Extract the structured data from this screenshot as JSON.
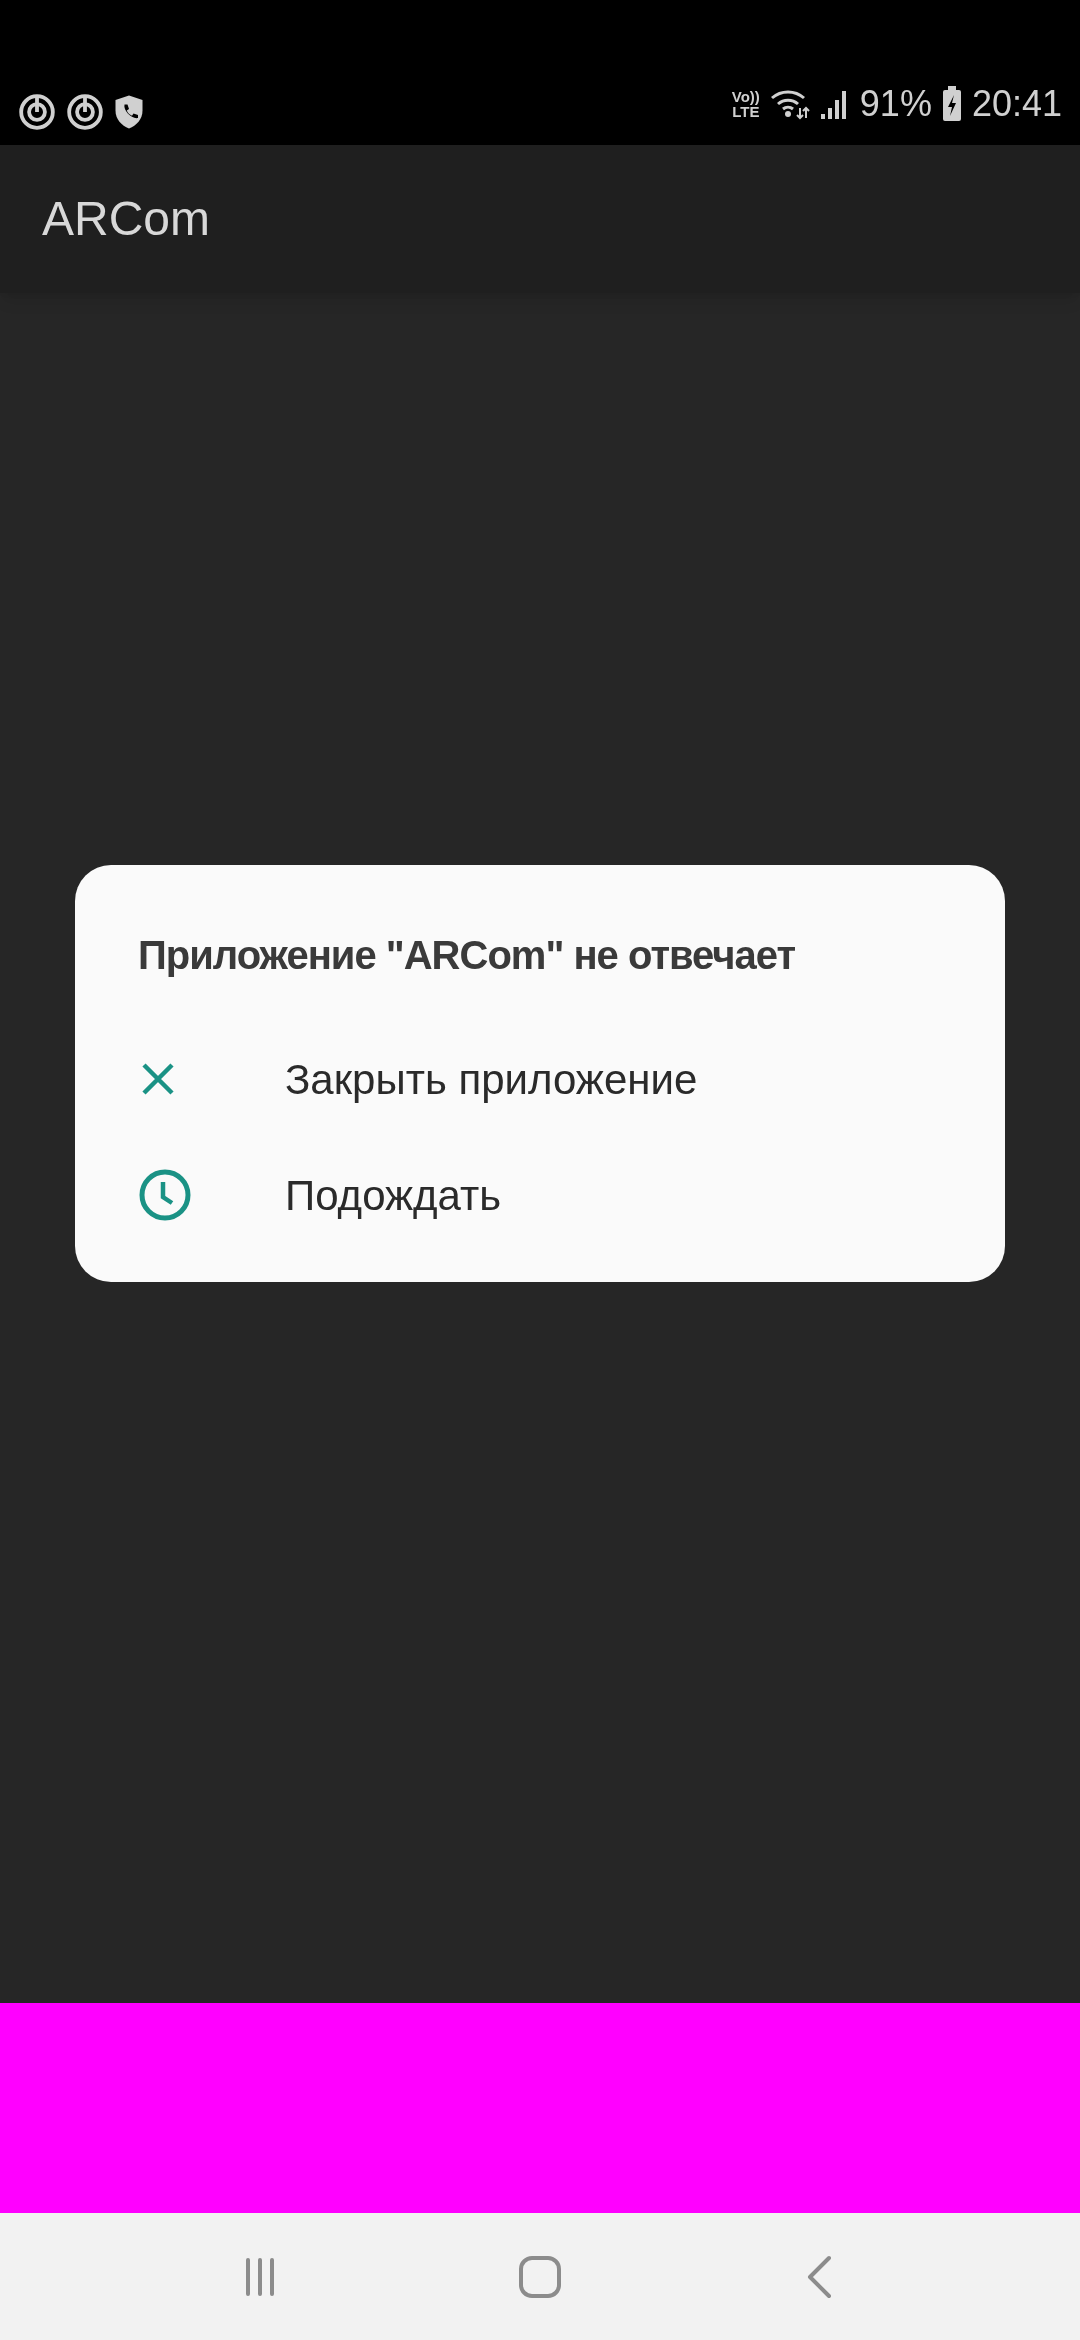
{
  "status_bar": {
    "network_badge": {
      "top": "Vo))",
      "bottom": "LTE"
    },
    "battery": "91%",
    "time": "20:41"
  },
  "app_bar": {
    "title": "ARCom"
  },
  "dialog": {
    "title": "Приложение \"ARCom\" не отвечает",
    "actions": [
      {
        "kind": "close",
        "label": "Закрыть приложение"
      },
      {
        "kind": "wait",
        "label": "Подождать"
      }
    ]
  }
}
